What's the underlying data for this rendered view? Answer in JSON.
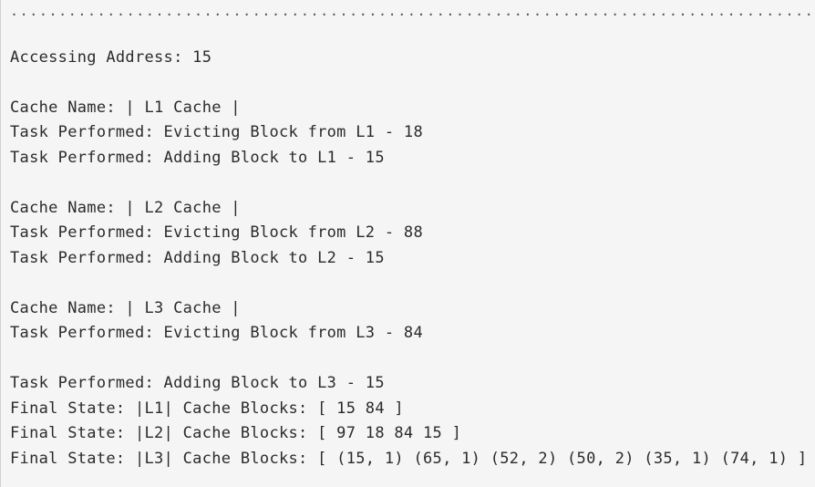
{
  "console": {
    "separator": "....................................................................................",
    "accessing_address": "Accessing Address: 15",
    "l1": {
      "name": "Cache Name: | L1 Cache |",
      "evict": "Task Performed: Evicting Block from L1 - 18",
      "add": "Task Performed: Adding Block to L1 - 15"
    },
    "l2": {
      "name": "Cache Name: | L2 Cache |",
      "evict": "Task Performed: Evicting Block from L2 - 88",
      "add": "Task Performed: Adding Block to L2 - 15"
    },
    "l3": {
      "name": "Cache Name: | L3 Cache |",
      "evict": "Task Performed: Evicting Block from L3 - 84",
      "add": "Task Performed: Adding Block to L3 - 15"
    },
    "final_state": {
      "l1": "Final State: |L1| Cache Blocks: [ 15 84 ]",
      "l2": "Final State: |L2| Cache Blocks: [ 97 18 84 15 ]",
      "l3": "Final State: |L3| Cache Blocks: [ (15, 1) (65, 1) (52, 2) (50, 2) (35, 1) (74, 1) ]"
    }
  }
}
